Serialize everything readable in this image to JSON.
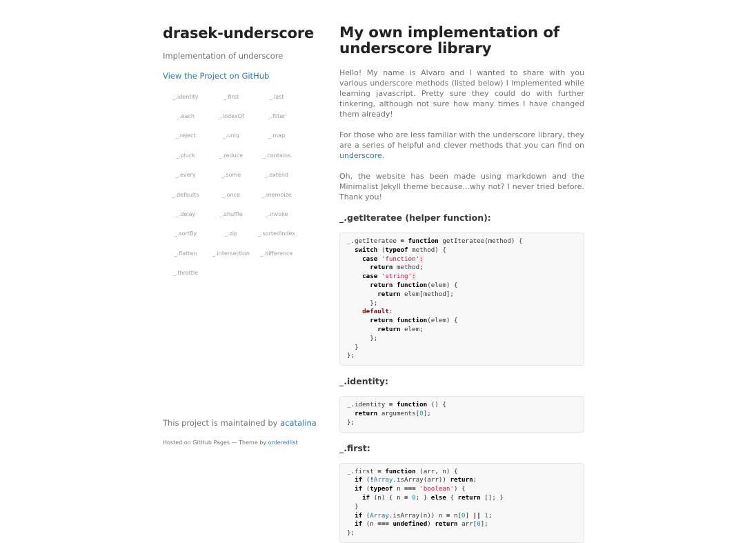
{
  "site": {
    "title": "drasek-underscore",
    "description": "Implementation of underscore",
    "github_link": "View the Project on GitHub",
    "methods": [
      "_.identity",
      "_.first",
      "_.last",
      "_.each",
      "_.indexOf",
      "_.filter",
      "_.reject",
      "_.uniq",
      "_.map",
      "_.pluck",
      "_.reduce",
      "_.contains",
      "_.every",
      "_.some",
      "_.extend",
      "_.defaults",
      "_.once",
      "_.memoize",
      "_.delay",
      "_.shuffle",
      "_.invoke",
      "_.sortBy",
      "_.zip",
      "_.sortedIndex",
      "_.flatten",
      "_.intersection",
      "_.difference",
      "_.throttle"
    ],
    "maintained_prefix": "This project is maintained by",
    "maintainer": "acatalina",
    "hosted_text": "Hosted on GitHub Pages — Theme by",
    "theme_author": "orderedlist"
  },
  "main": {
    "title": "My own implementation of underscore library",
    "para1": "Hello! My name is Alvaro and I wanted to share with you various underscore methods (listed below) I implemented while learning javascript. Pretty sure they could do with further tinkering, although not sure how many times I have changed them already!",
    "para2_prefix": "For those who are less familiar with the underscore library, they are a series of helpful and clever methods that you can find on",
    "para2_link": "underscore",
    "para2_suffix": ".",
    "para3": "Oh, the website has been made using markdown and the Minimalist Jekyll theme because...why not? I never tried before. Thank you!",
    "sections": [
      {
        "heading": "_.getIteratee (helper function):"
      },
      {
        "heading": "_.identity:"
      },
      {
        "heading": "_.first:"
      }
    ]
  },
  "colors": {
    "link": "#267CB9",
    "heading": "#222222",
    "body_text": "#727272",
    "code_bg": "#f8f8f8",
    "string": "#dd1144"
  }
}
